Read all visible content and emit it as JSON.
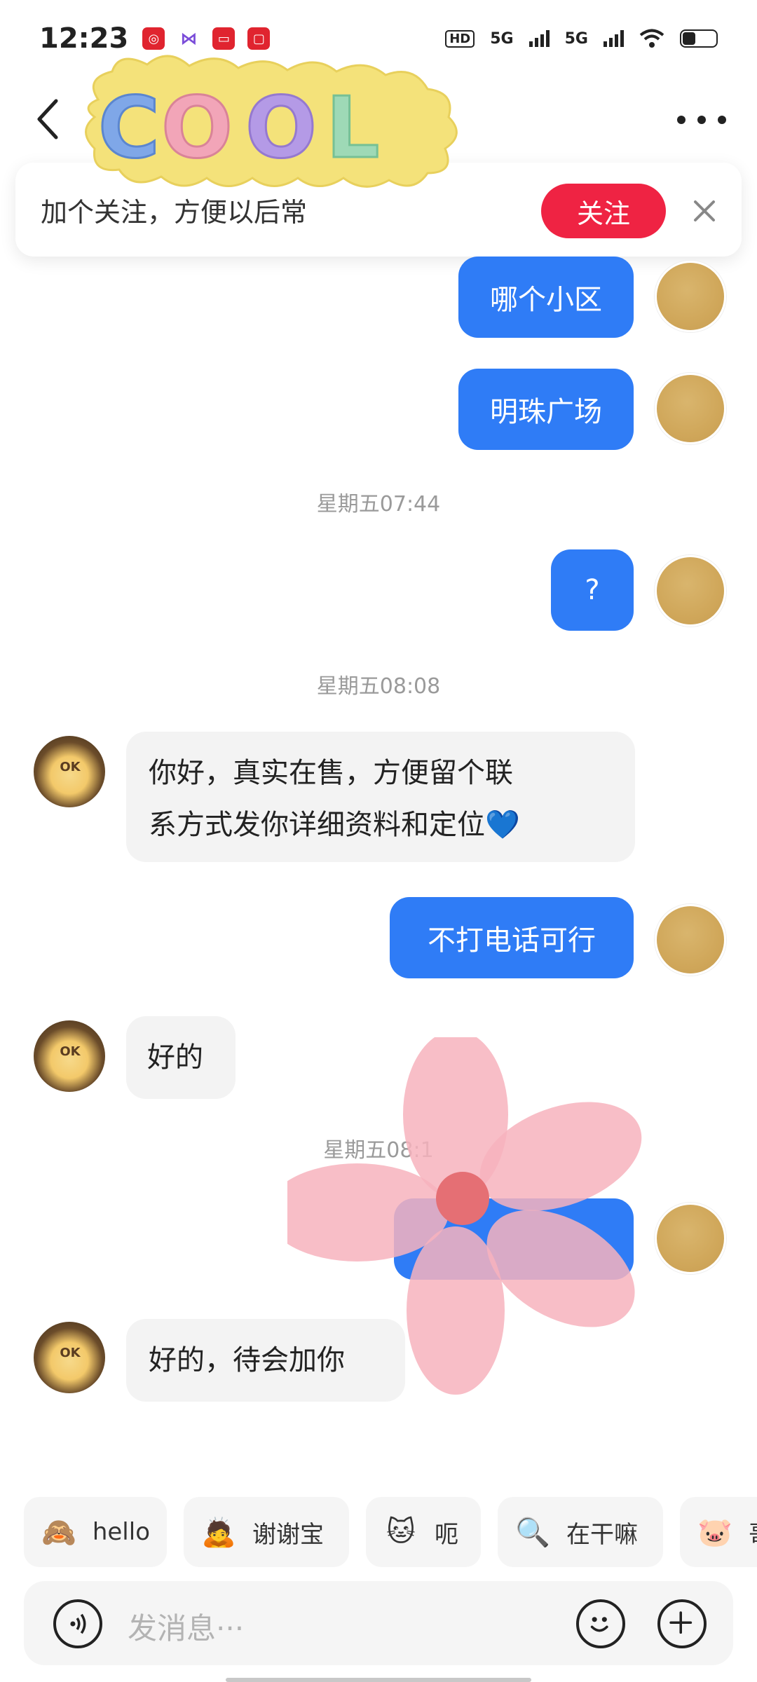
{
  "status_bar": {
    "time": "12:23",
    "app_icons": [
      "target-app-icon",
      "butterfly-app-icon",
      "news-app-icon",
      "red-app-icon"
    ],
    "hd_label": "HD",
    "network_1": "5G",
    "network_2": "5G",
    "battery_level": 0.4
  },
  "header": {
    "back_icon": "chevron-left-icon",
    "more_icon": "more-dots-icon"
  },
  "follow_banner": {
    "text": "加个关注，方便以后常",
    "follow_label": "关注",
    "close_icon": "close-icon"
  },
  "messages": [
    {
      "sender": "me",
      "text": "哪个小区"
    },
    {
      "sender": "me",
      "text": "明珠广场"
    },
    {
      "type": "time",
      "text": "星期五07:44"
    },
    {
      "sender": "me",
      "text": "?"
    },
    {
      "type": "time",
      "text": "星期五08:08"
    },
    {
      "sender": "other",
      "text_line1": "你好，真实在售，方便留个联",
      "text_line2": "系方式发你详细资料和定位💙"
    },
    {
      "sender": "me",
      "text": "不打电话可行"
    },
    {
      "sender": "other",
      "text": "好的"
    },
    {
      "type": "time",
      "text": "星期五08:1"
    },
    {
      "sender": "me",
      "text": ""
    },
    {
      "sender": "other",
      "text": "好的，待会加你"
    }
  ],
  "quick_replies": [
    {
      "emoji": "🙈",
      "label": "hello"
    },
    {
      "emoji": "🙇",
      "label": "谢谢宝"
    },
    {
      "emoji": "🐱",
      "label": "呃"
    },
    {
      "emoji": "🔍",
      "label": "在干嘛"
    },
    {
      "emoji": "🐷",
      "label": "哥"
    }
  ],
  "input": {
    "placeholder": "发消息···",
    "voice_icon": "voice-icon",
    "emoji_icon": "smiley-icon",
    "plus_icon": "plus-icon"
  },
  "colors": {
    "outgoing_bubble": "#2f7cf6",
    "incoming_bubble": "#f3f3f3",
    "follow_button": "#ef2343"
  }
}
